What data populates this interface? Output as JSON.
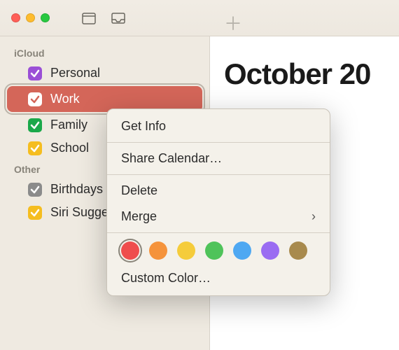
{
  "header": {
    "month_title": "October 20"
  },
  "sidebar": {
    "sections": [
      {
        "title": "iCloud",
        "items": [
          {
            "label": "Personal",
            "color": "#9a4fd6",
            "checked": true,
            "selected": false
          },
          {
            "label": "Work",
            "color": "#ffffff",
            "bg": "#d46659",
            "checked": true,
            "selected": true
          },
          {
            "label": "Family",
            "color": "#1aa84a",
            "checked": true,
            "selected": false
          },
          {
            "label": "School",
            "color": "#f5bd1f",
            "checked": true,
            "selected": false
          }
        ]
      },
      {
        "title": "Other",
        "items": [
          {
            "label": "Birthdays",
            "color": "#8b8b8b",
            "checked": true,
            "selected": false
          },
          {
            "label": "Siri Suggestions",
            "color": "#f5bd1f",
            "checked": true,
            "selected": false
          }
        ]
      }
    ]
  },
  "context_menu": {
    "get_info": "Get Info",
    "share": "Share Calendar…",
    "delete": "Delete",
    "merge": "Merge",
    "custom_color": "Custom Color…",
    "swatches": [
      {
        "color": "#ef4d4d",
        "selected": true
      },
      {
        "color": "#f5933b",
        "selected": false
      },
      {
        "color": "#f5cc3b",
        "selected": false
      },
      {
        "color": "#4fc35a",
        "selected": false
      },
      {
        "color": "#4ea8f2",
        "selected": false
      },
      {
        "color": "#9a6cf2",
        "selected": false
      },
      {
        "color": "#a88a4d",
        "selected": false
      }
    ]
  }
}
